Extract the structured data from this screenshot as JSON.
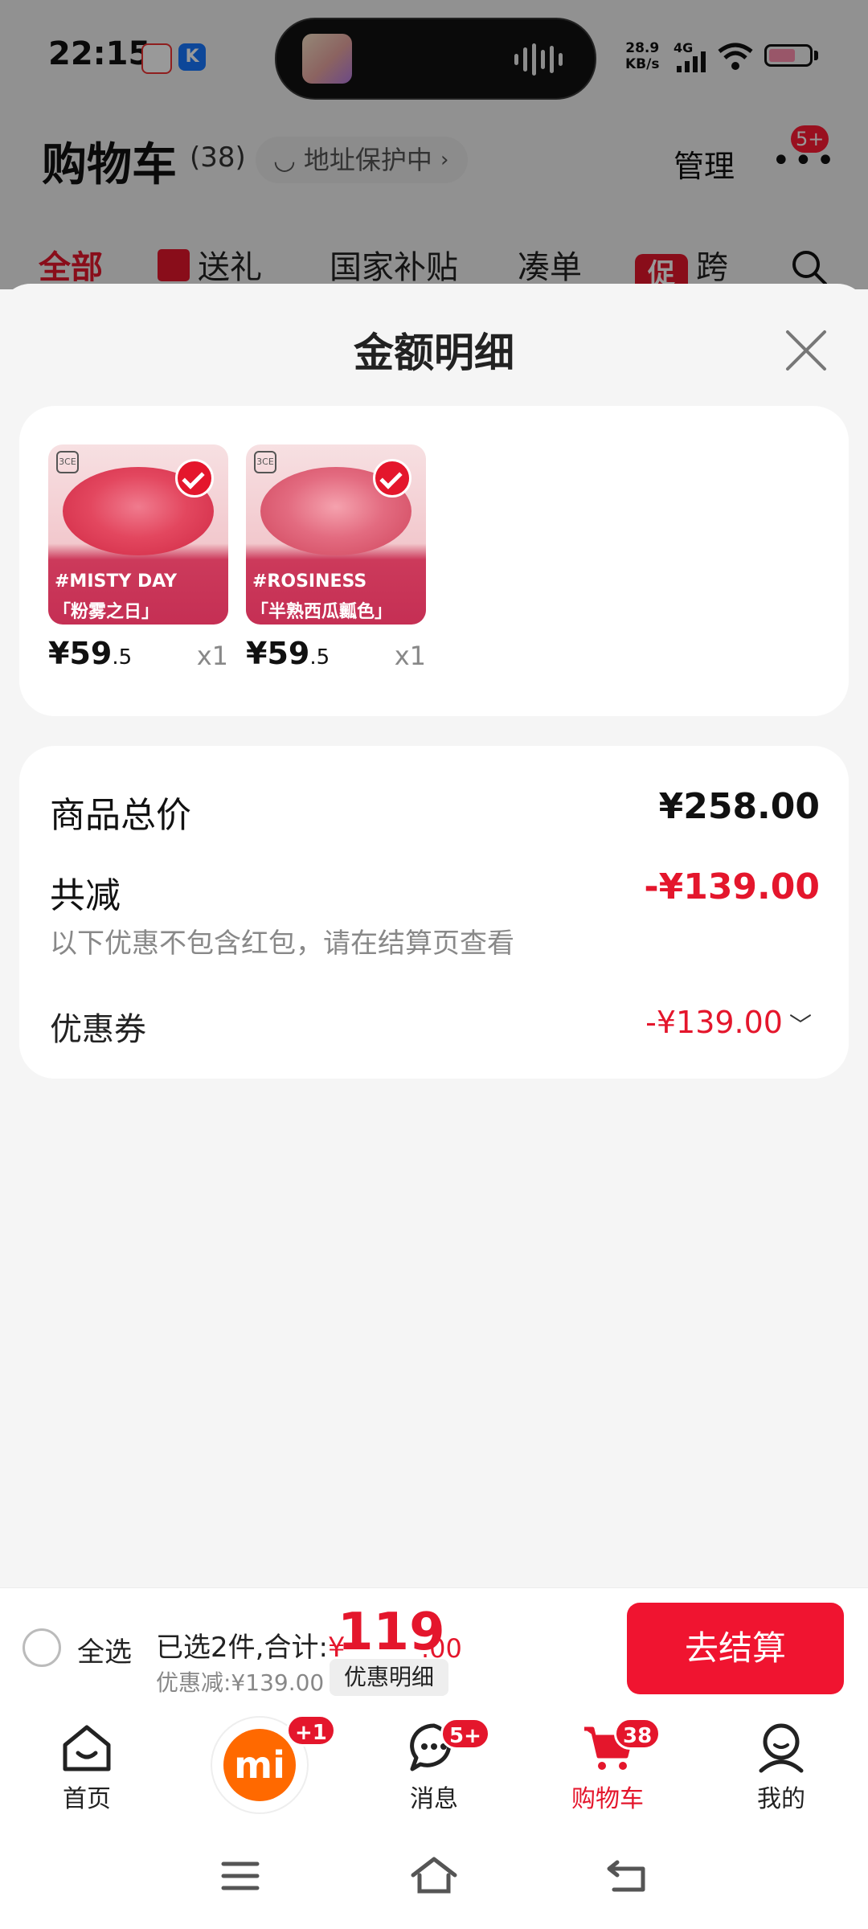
{
  "status_bar": {
    "time": "22:15",
    "net_speed_value": "28.9",
    "net_speed_unit": "KB/s",
    "network": "4G",
    "app_icons": [
      "mic-app-icon",
      "k-app-icon"
    ]
  },
  "background_page": {
    "title": "购物车",
    "count": "(38)",
    "address_pill": "地址保护中",
    "manage": "管理",
    "more_badge": "5+",
    "tabs": [
      {
        "label": "全部",
        "active": true
      },
      {
        "label": "送礼",
        "icon": "gift-icon"
      },
      {
        "label": "国家补贴"
      },
      {
        "label": "凑单"
      },
      {
        "label": "跨",
        "icon_text": "促"
      }
    ]
  },
  "sheet": {
    "title": "金额明细",
    "products": [
      {
        "shade_code": "#MISTY DAY",
        "shade_name": "「粉雾之日」",
        "price_int": "¥59",
        "price_dec": ".5",
        "qty": "x1",
        "checked": true
      },
      {
        "shade_code": "#ROSINESS",
        "shade_name": "「半熟西瓜瓤色」",
        "price_int": "¥59",
        "price_dec": ".5",
        "qty": "x1",
        "checked": true
      }
    ],
    "summary": {
      "total_label": "商品总价",
      "total_value": "¥258.00",
      "discount_label": "共减",
      "discount_value": "-¥139.00",
      "note": "以下优惠不包含红包，请在结算页查看",
      "coupon_label": "优惠券",
      "coupon_value": "-¥139.00"
    }
  },
  "checkout": {
    "select_all": "全选",
    "selected_prefix": "已选2件,合计:",
    "total_currency": "¥",
    "total_int": "119",
    "total_dec": ".00",
    "discount_note": "优惠减:¥139.00",
    "detail_chip": "优惠明细",
    "button": "去结算"
  },
  "tabbar": {
    "items": [
      {
        "label": "首页",
        "icon": "home-icon"
      },
      {
        "label": "",
        "icon": "mi-logo-icon",
        "badge": "+1"
      },
      {
        "label": "消息",
        "icon": "message-icon",
        "badge": "5+"
      },
      {
        "label": "购物车",
        "icon": "cart-icon",
        "badge": "38",
        "active": true
      },
      {
        "label": "我的",
        "icon": "profile-icon"
      }
    ]
  },
  "colors": {
    "accent": "#e4162c",
    "button": "#f01430",
    "mi_orange": "#ff6900"
  }
}
